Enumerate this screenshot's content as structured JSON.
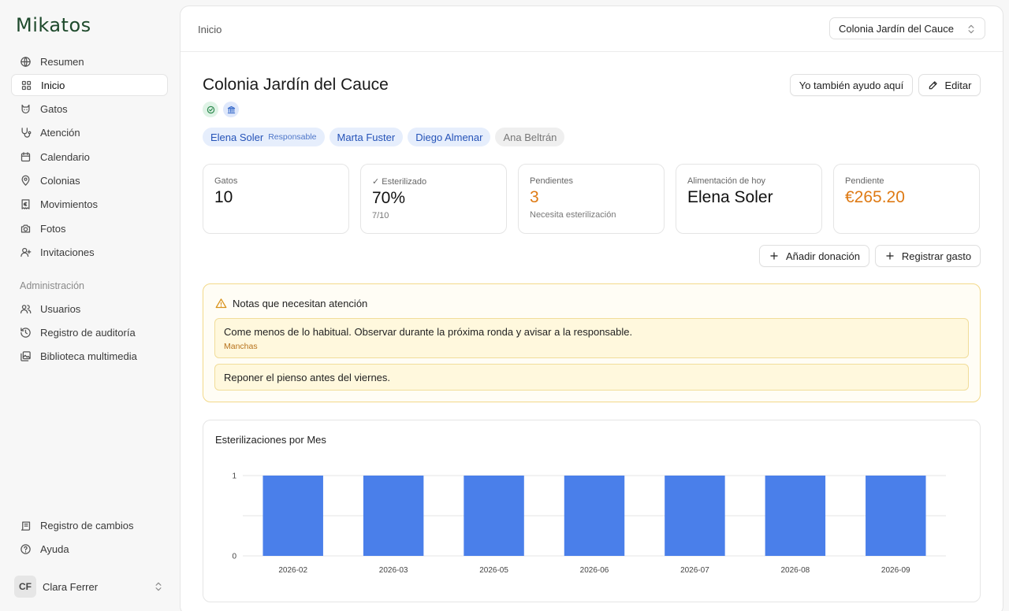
{
  "app": {
    "logo": "Mikatos"
  },
  "sidebar": {
    "items": [
      {
        "label": "Resumen",
        "icon": "globe-icon"
      },
      {
        "label": "Inicio",
        "icon": "grid-icon",
        "active": true
      },
      {
        "label": "Gatos",
        "icon": "cat-icon"
      },
      {
        "label": "Atención",
        "icon": "stethoscope-icon"
      },
      {
        "label": "Calendario",
        "icon": "calendar-icon"
      },
      {
        "label": "Colonias",
        "icon": "map-pin-icon"
      },
      {
        "label": "Movimientos",
        "icon": "euro-receipt-icon"
      },
      {
        "label": "Fotos",
        "icon": "camera-icon"
      },
      {
        "label": "Invitaciones",
        "icon": "user-plus-icon"
      }
    ],
    "admin_label": "Administración",
    "admin_items": [
      {
        "label": "Usuarios",
        "icon": "users-icon"
      },
      {
        "label": "Registro de auditoría",
        "icon": "history-icon"
      },
      {
        "label": "Biblioteca multimedia",
        "icon": "images-icon"
      }
    ],
    "bottom_items": [
      {
        "label": "Registro de cambios",
        "icon": "scroll-icon"
      },
      {
        "label": "Ayuda",
        "icon": "help-circle-icon"
      }
    ],
    "user": {
      "initials": "CF",
      "name": "Clara Ferrer"
    }
  },
  "header": {
    "breadcrumb": "Inicio",
    "colony_select": "Colonia Jardín del Cauce"
  },
  "page": {
    "title": "Colonia Jardín del Cauce",
    "help_button": "Yo también ayudo aquí",
    "edit_button": "Editar",
    "people": [
      {
        "name": "Elena Soler",
        "role": "Responsable",
        "style": "blue"
      },
      {
        "name": "Marta Fuster",
        "style": "blue"
      },
      {
        "name": "Diego Almenar",
        "style": "blue"
      },
      {
        "name": "Ana Beltrán",
        "style": "gray"
      }
    ]
  },
  "stats": [
    {
      "label": "Gatos",
      "value": "10",
      "sub": ""
    },
    {
      "label": "✓ Esterilizado",
      "value": "70%",
      "sub": "7/10"
    },
    {
      "label": "Pendientes",
      "value": "3",
      "sub": "Necesita esterilización",
      "accent": "orange"
    },
    {
      "label": "Alimentación de hoy",
      "value": "Elena Soler",
      "sub": ""
    },
    {
      "label": "Pendiente",
      "value": "€265.20",
      "sub": "",
      "accent": "orange"
    }
  ],
  "actions": {
    "add_donation": "Añadir donación",
    "add_expense": "Registrar gasto"
  },
  "notes": {
    "title": "Notas que necesitan atención",
    "items": [
      {
        "text": "Come menos de lo habitual. Observar durante la próxima ronda y avisar a la responsable.",
        "tag": "Manchas"
      },
      {
        "text": "Reponer el pienso antes del viernes.",
        "tag": ""
      }
    ]
  },
  "colors": {
    "accent_orange": "#de7a14",
    "bar_blue": "#4a7fea",
    "chip_blue_text": "#2553b8"
  },
  "chart_data": {
    "type": "bar",
    "title": "Esterilizaciones por Mes",
    "categories": [
      "2026-02",
      "2026-03",
      "2026-05",
      "2026-06",
      "2026-07",
      "2026-08",
      "2026-09"
    ],
    "values": [
      1,
      1,
      1,
      1,
      1,
      1,
      1
    ],
    "yticks": [
      "0",
      "1"
    ],
    "ylim": [
      0,
      1
    ],
    "grid": true,
    "xlabel": "",
    "ylabel": ""
  }
}
